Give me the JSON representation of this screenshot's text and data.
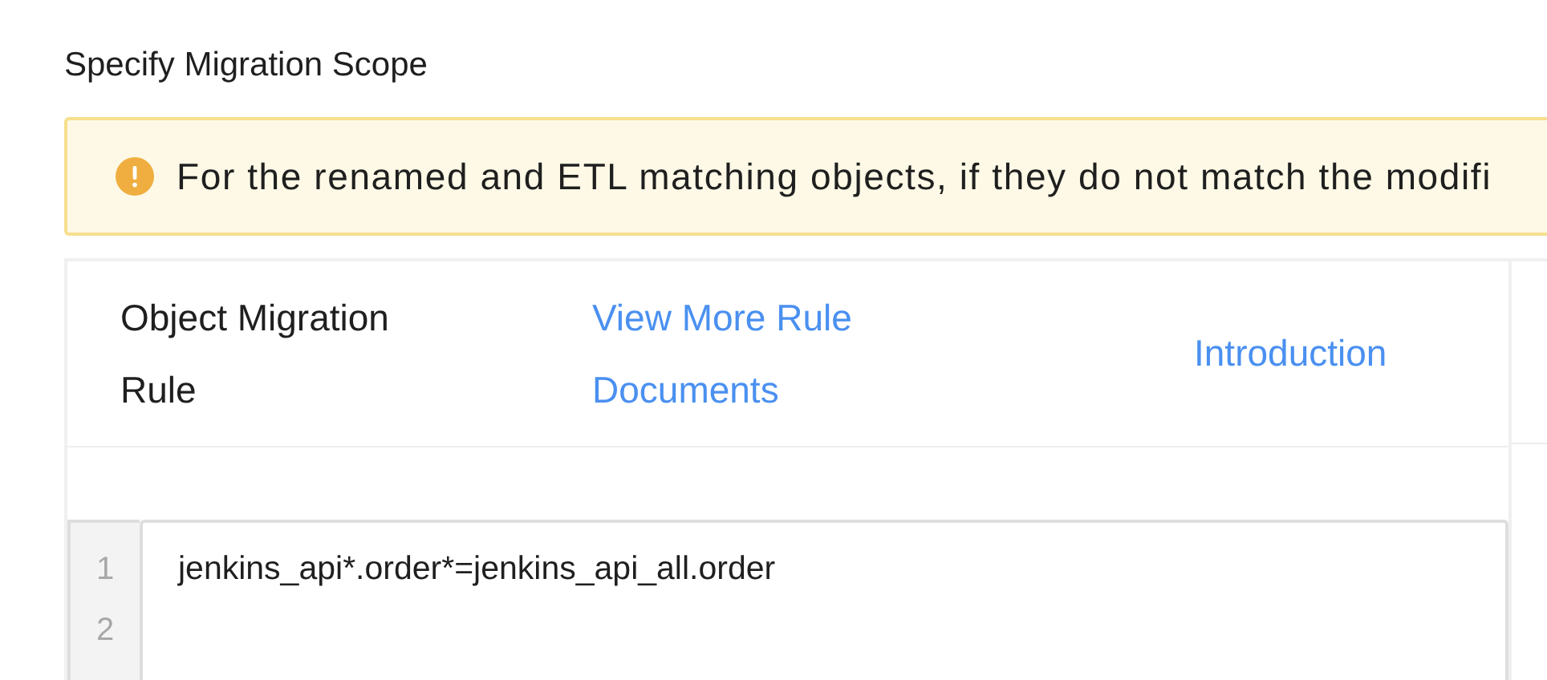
{
  "section_title": "Specify Migration Scope",
  "alert": {
    "text": "For the renamed and ETL matching objects, if they do not match the modifi"
  },
  "rule_card": {
    "title": "Object Migration Rule",
    "links": [
      "View More Rule Documents",
      "Introduction"
    ],
    "editor": {
      "line_numbers": [
        "1",
        "2"
      ],
      "lines": [
        "jenkins_api*.order*=jenkins_api_all.order"
      ]
    }
  }
}
